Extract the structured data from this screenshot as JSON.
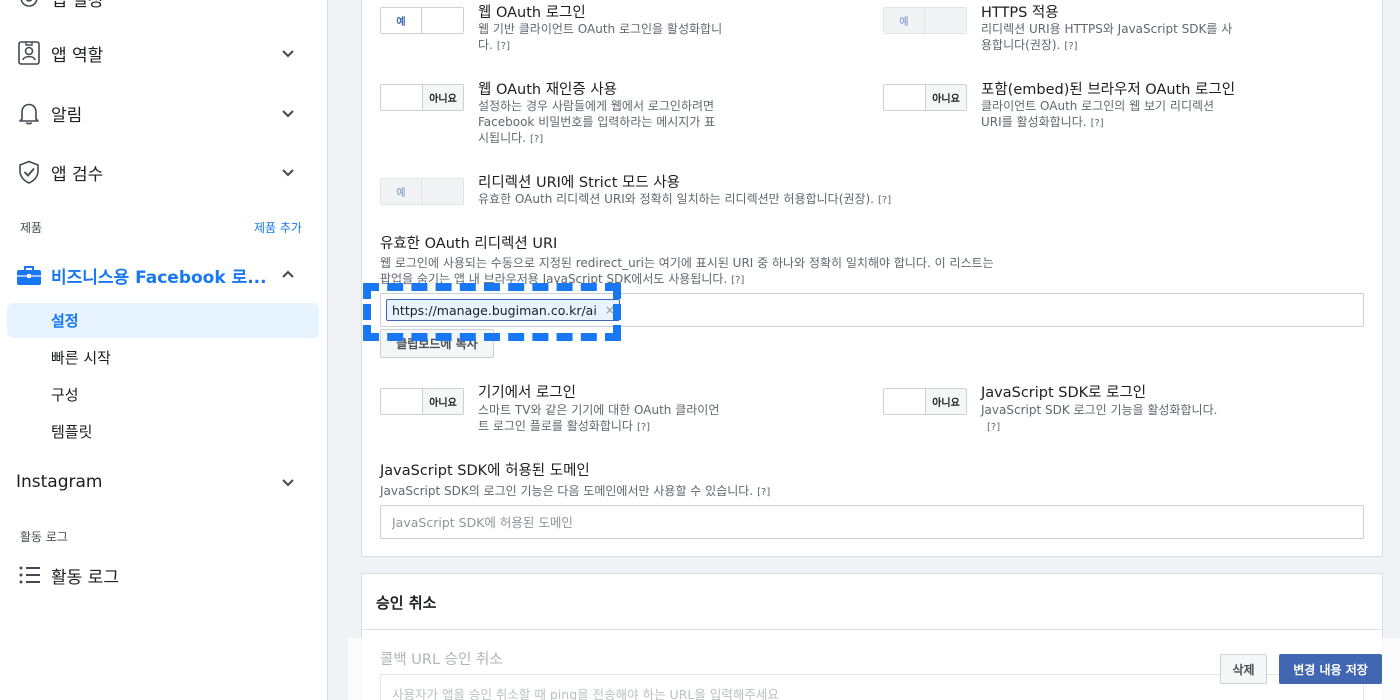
{
  "sidebar": {
    "top_partial": "앱 설정",
    "items": [
      {
        "label": "앱 역할",
        "icon": "user-badge-icon"
      },
      {
        "label": "알림",
        "icon": "bell-icon"
      },
      {
        "label": "앱 검수",
        "icon": "shield-check-icon"
      }
    ],
    "products_label": "제품",
    "add_product": "제품 추가",
    "product": {
      "label": "비즈니스용 Facebook 로...",
      "icon": "briefcase-icon"
    },
    "sub_items": [
      "설정",
      "빠른 시작",
      "구성",
      "템플릿"
    ],
    "instagram_label": "Instagram",
    "activity_section": "활동 로그",
    "activity_item": "활동 로그"
  },
  "settings": {
    "toggle_yes": "예",
    "toggle_no": "아니요",
    "help": "[?]",
    "web_oauth": {
      "title": "웹 OAuth 로그인",
      "desc1": "웹 기반 클라이언트 OAuth 로그인을 활성화합니",
      "desc2": "다.",
      "state": "on"
    },
    "https": {
      "title": "HTTPS 적용",
      "desc1": "리디렉션 URI용 HTTPS와 JavaScript SDK를 사",
      "desc2": "용합니다(권장).",
      "state": "on-disabled"
    },
    "reauth": {
      "title": "웹 OAuth 재인증 사용",
      "desc1": "설정하는 경우 사람들에게 웹에서 로그인하려면",
      "desc2": "Facebook 비밀번호를 입력하라는 메시지가 표",
      "desc3": "시됩니다.",
      "state": "off"
    },
    "embedded": {
      "title": "포함(embed)된 브라우저 OAuth 로그인",
      "desc1": "클라이언트 OAuth 로그인의 웹 보기 리디렉션",
      "desc2": "URI를 활성화합니다.",
      "state": "off"
    },
    "strict": {
      "title": "리디렉션 URI에 Strict 모드 사용",
      "desc": "유효한 OAuth 리디렉션 URI와 정확히 일치하는 리디렉션만 허용합니다(권장).",
      "state": "on-disabled"
    },
    "redirect_uri": {
      "title": "유효한 OAuth 리디렉션 URI",
      "desc1": "웹 로그인에 사용되는 수동으로 지정된 redirect_uri는 여기에 표시된 URI 중 하나와 정확히 일치해야 합니다. 이 리스트는",
      "desc2": "팝업을 숨기는 앱 내 브라우저용 JavaScript SDK에서도 사용됩니다.",
      "chip": "https://manage.bugiman.co.kr/ai",
      "chip_remove": "×",
      "copy_button": "클립보드에 복사"
    },
    "device": {
      "title": "기기에서 로그인",
      "desc1": "스마트 TV와 같은 기기에 대한 OAuth 클라이언",
      "desc2": "트 로그인 플로를 활성화합니다",
      "state": "off"
    },
    "jssdk": {
      "title": "JavaScript SDK로 로그인",
      "desc1": "JavaScript SDK 로그인 기능을 활성화합니다.",
      "state": "off"
    },
    "domains": {
      "title": "JavaScript SDK에 허용된 도메인",
      "desc": "JavaScript SDK의 로그인 기능은 다음 도메인에서만 사용할 수 있습니다.",
      "placeholder": "JavaScript SDK에 허용된 도메인"
    }
  },
  "deauth": {
    "title": "승인 취소",
    "callback_label": "콜백 URL 승인 취소",
    "callback_placeholder": "사용자가 앱을 승인 취소할 때 ping을 전송해야 하는 URL을 입력해주세요"
  },
  "actions": {
    "delete": "삭제",
    "save": "변경 내용 저장"
  },
  "colors": {
    "accent": "#1877f2",
    "button_primary": "#4267b2",
    "active_bg": "#e7f3ff"
  }
}
